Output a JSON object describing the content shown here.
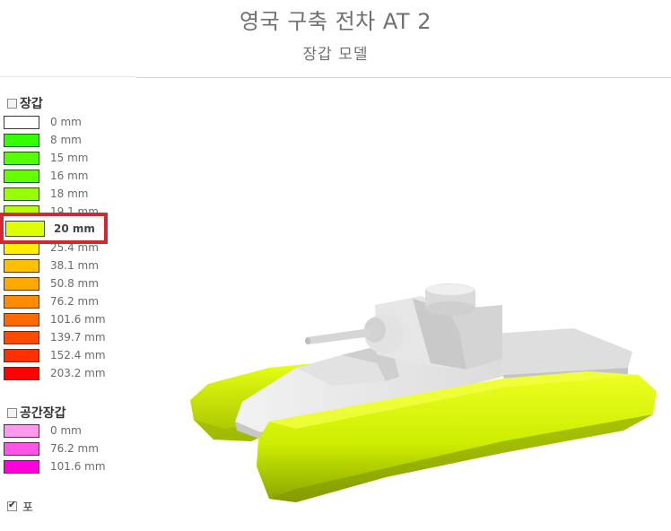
{
  "header": {
    "title": "영국 구축 전차 AT 2",
    "subtitle": "장갑 모델"
  },
  "armor": {
    "label": "장갑",
    "checked": false,
    "items": [
      {
        "label": "0 mm",
        "color": "#ffffff"
      },
      {
        "label": "8 mm",
        "color": "#33ff00"
      },
      {
        "label": "15 mm",
        "color": "#55ff00"
      },
      {
        "label": "16 mm",
        "color": "#66ff00"
      },
      {
        "label": "18 mm",
        "color": "#99ff00"
      },
      {
        "label": "19.1 mm",
        "color": "#bbff00"
      },
      {
        "label": "20 mm",
        "color": "#ddff00"
      },
      {
        "label": "25.4 mm",
        "color": "#ffee00"
      },
      {
        "label": "38.1 mm",
        "color": "#ffc000"
      },
      {
        "label": "50.8 mm",
        "color": "#ffa800"
      },
      {
        "label": "76.2 mm",
        "color": "#ff8c00"
      },
      {
        "label": "101.6 mm",
        "color": "#ff6a00"
      },
      {
        "label": "139.7 mm",
        "color": "#ff4b00"
      },
      {
        "label": "152.4 mm",
        "color": "#ff3000"
      },
      {
        "label": "203.2 mm",
        "color": "#ff0000"
      }
    ]
  },
  "spaced_armor": {
    "label": "공간장갑",
    "checked": false,
    "items": [
      {
        "label": "0 mm",
        "color": "#ff99ee"
      },
      {
        "label": "76.2 mm",
        "color": "#ff55e6"
      },
      {
        "label": "101.6 mm",
        "color": "#ff00dd"
      }
    ]
  },
  "gun": {
    "label": "포",
    "checked": true
  },
  "highlight": {
    "label": "20 mm",
    "color": "#ddff00",
    "frame_color": "#d6262f"
  },
  "model": {
    "track_color": "#ddff00",
    "hull_color": "#e8e8e8"
  }
}
